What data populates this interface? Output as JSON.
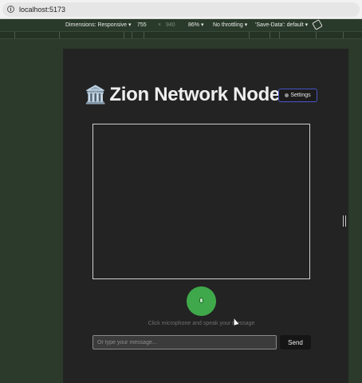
{
  "browser": {
    "url": "localhost:5173",
    "info_icon": "info-icon"
  },
  "devtools": {
    "dimensions_label": "Dimensions: Responsive",
    "dropdown_arrow": "▾",
    "width": "755",
    "times": "×",
    "height": "940",
    "zoom": "86%",
    "throttling": "No throttling",
    "save_data": "'Save-Data': default",
    "rotate_icon": "rotate-icon"
  },
  "app": {
    "title_icon": "🏛️",
    "title": "Zion Network Node",
    "settings_label": "Settings",
    "mic_icon": "microphone-icon",
    "hint": "Click microphone and speak your message",
    "input_placeholder": "Or type your message...",
    "send_label": "Send"
  },
  "colors": {
    "app_bg": "#232323",
    "mic_green": "#3fa84a",
    "settings_border": "#4a55c8",
    "page_bg": "#2b3a2a"
  }
}
